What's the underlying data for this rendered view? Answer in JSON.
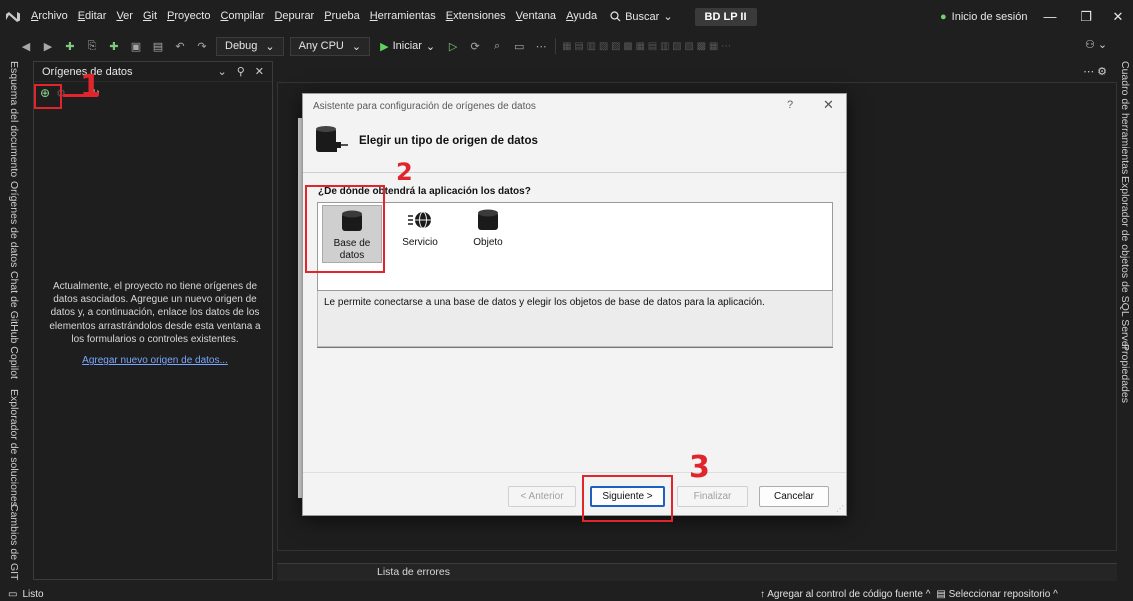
{
  "menubar": {
    "logo": "VS",
    "items": [
      "Archivo",
      "Editar",
      "Ver",
      "Git",
      "Proyecto",
      "Compilar",
      "Depurar",
      "Prueba",
      "Herramientas",
      "Extensiones",
      "Ventana",
      "Ayuda"
    ],
    "search": "Buscar",
    "solution": "BD LP II",
    "signin": "Inicio de sesión"
  },
  "toolbar": {
    "config": "Debug",
    "platform": "Any CPU",
    "start": "Iniciar"
  },
  "left_tabs": [
    "Esquema del documento",
    "Orígenes de datos",
    "Chat de GitHub Copilot",
    "Explorador de soluciones",
    "Cambios de GIT"
  ],
  "right_tabs": [
    "Cuadro de herramientas",
    "Explorador de objetos de SQL Server",
    "Propiedades"
  ],
  "ds_panel": {
    "title": "Orígenes de datos",
    "message": "Actualmente, el proyecto no tiene orígenes de datos asociados. Agregue un nuevo origen de datos y, a continuación, enlace los datos de los elementos arrastrándolos desde esta ventana a los formularios o controles existentes.",
    "add_link": "Agregar nuevo origen de datos..."
  },
  "dialog": {
    "title": "Asistente para configuración de orígenes de datos",
    "help": "?",
    "close": "✕",
    "heading": "Elegir un tipo de origen de datos",
    "question": "¿De dónde obtendrá la aplicación los datos?",
    "sources": [
      {
        "label": "Base de datos",
        "selected": true
      },
      {
        "label": "Servicio",
        "selected": false
      },
      {
        "label": "Objeto",
        "selected": false
      }
    ],
    "description": "Le permite conectarse a una base de datos y elegir los objetos de base de datos para la aplicación.",
    "buttons": {
      "back": "< Anterior",
      "next": "Siguiente >",
      "finish": "Finalizar",
      "cancel": "Cancelar"
    }
  },
  "error_list": "Lista de errores",
  "status": {
    "text": "Listo",
    "source_control": "Agregar al control de código fuente",
    "repo": "Seleccionar repositorio"
  },
  "annotations": [
    "1",
    "2",
    "3"
  ],
  "colors": {
    "annotation": "#e0262c",
    "link": "#7aa6ff",
    "start": "#5fd35f"
  }
}
